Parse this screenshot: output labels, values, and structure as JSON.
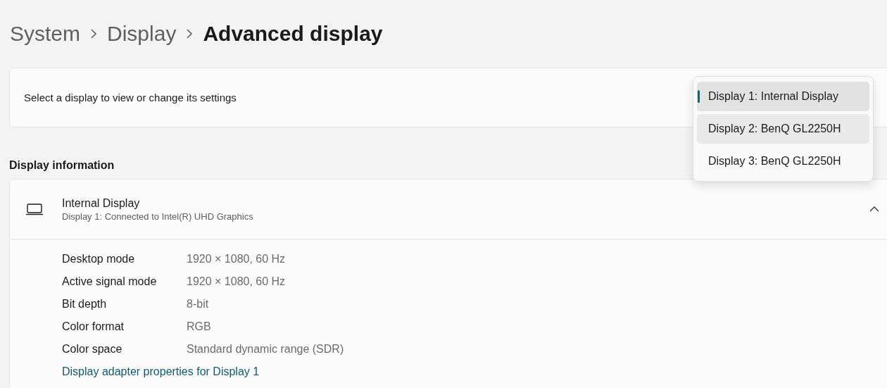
{
  "breadcrumb": [
    {
      "label": "System",
      "current": false
    },
    {
      "label": "Display",
      "current": false
    },
    {
      "label": "Advanced display",
      "current": true
    }
  ],
  "display_select": {
    "prompt": "Select a display to view or change its settings",
    "options": [
      {
        "label": "Display 1: Internal Display",
        "selected": true,
        "hovered": false
      },
      {
        "label": "Display 2: BenQ GL2250H",
        "selected": false,
        "hovered": true
      },
      {
        "label": "Display 3: BenQ GL2250H",
        "selected": false,
        "hovered": false
      }
    ]
  },
  "section_title": "Display information",
  "info_card": {
    "title": "Internal Display",
    "subtitle": "Display 1: Connected to Intel(R) UHD Graphics",
    "expanded": true,
    "rows": [
      {
        "label": "Desktop mode",
        "value": "1920 × 1080, 60 Hz"
      },
      {
        "label": "Active signal mode",
        "value": "1920 × 1080, 60 Hz"
      },
      {
        "label": "Bit depth",
        "value": "8-bit"
      },
      {
        "label": "Color format",
        "value": "RGB"
      },
      {
        "label": "Color space",
        "value": "Standard dynamic range (SDR)"
      }
    ],
    "link": "Display adapter properties for Display 1"
  }
}
